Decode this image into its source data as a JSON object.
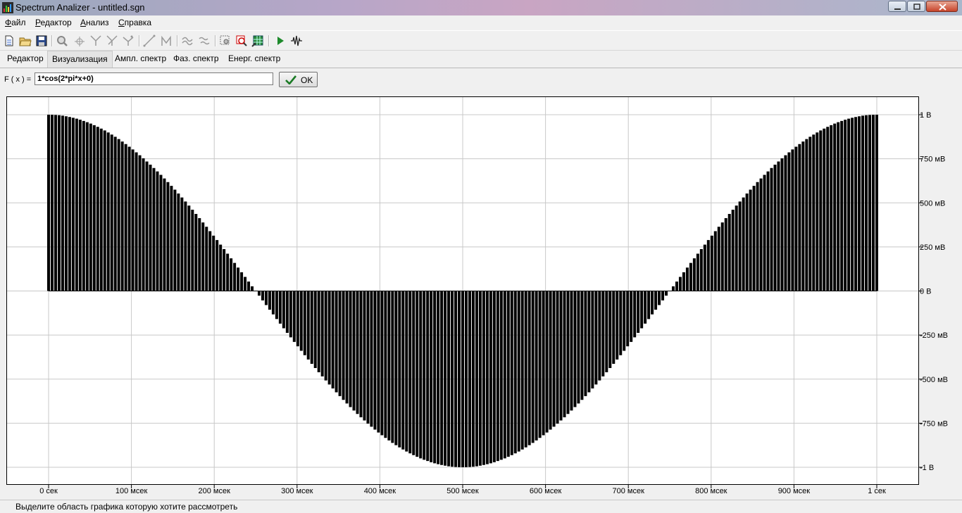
{
  "window": {
    "title": "Spectrum Analizer - untitled.sgn"
  },
  "menu": [
    "Файл",
    "Редактор",
    "Анализ",
    "Справка"
  ],
  "toolbar": {
    "icons": [
      "new-icon",
      "open-icon",
      "save-icon",
      "zoom-icon",
      "crosshair-icon",
      "filter-icon",
      "filter2-icon",
      "filter3-icon",
      "line-icon",
      "bracket-icon",
      "stretch-icon",
      "compress-icon",
      "select-icon",
      "zoom-area-icon",
      "grid-icon",
      "play-icon",
      "waveform-icon"
    ]
  },
  "tabs": [
    "Редактор",
    "Визуализация",
    "Ампл. спектр",
    "Фаз. спектр",
    "Енерг. спектр"
  ],
  "formula": {
    "label": "F ( x ) =",
    "value": "1*cos(2*pi*x+0)",
    "ok_label": "OK"
  },
  "status": {
    "text": "Выделите область графика которую хотите рассмотреть"
  },
  "chart_data": {
    "type": "line",
    "function": "1*cos(2*pi*x+0)",
    "x_range": [
      0,
      1
    ],
    "y_range": [
      -1,
      1
    ],
    "x_ticks": [
      "0 сек",
      "100 мсек",
      "200 мсек",
      "300 мсек",
      "400 мсек",
      "500 мсек",
      "600 мсек",
      "700 мсек",
      "800 мсек",
      "900 мсек",
      "1 сек"
    ],
    "x_tick_values": [
      0,
      0.1,
      0.2,
      0.3,
      0.4,
      0.5,
      0.6,
      0.7,
      0.8,
      0.9,
      1.0
    ],
    "y_ticks": [
      "1 В",
      "750 мВ",
      "500 мВ",
      "250 мВ",
      "0 В",
      "-250 мВ",
      "-500 мВ",
      "-750 мВ",
      "-1 В"
    ],
    "y_tick_values": [
      1,
      0.75,
      0.5,
      0.25,
      0,
      -0.25,
      -0.5,
      -0.75,
      -1
    ],
    "grid": true,
    "series_color": "#000000"
  }
}
